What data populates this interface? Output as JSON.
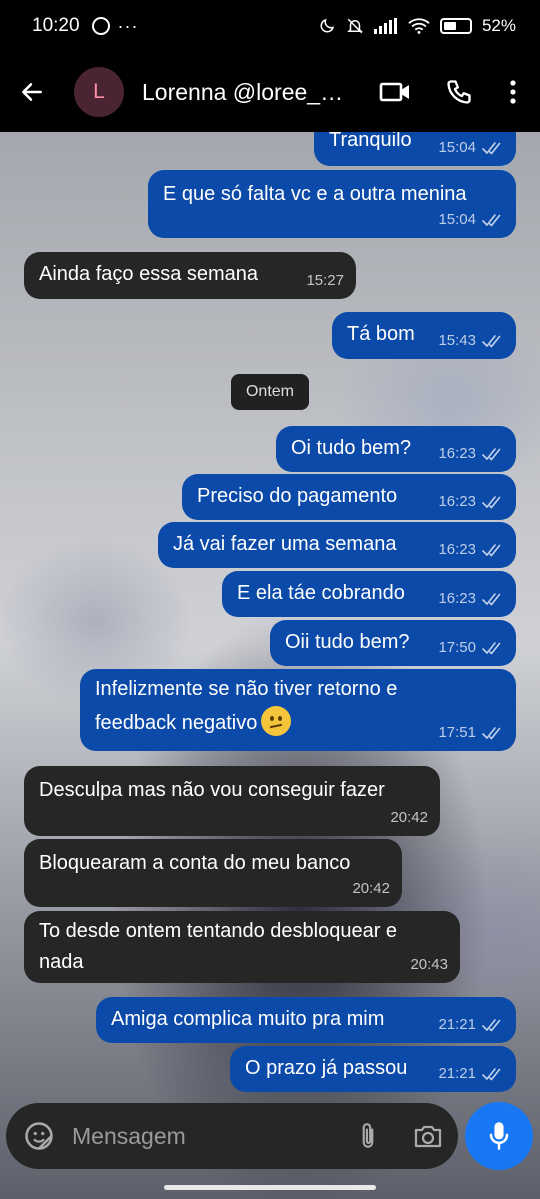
{
  "status_bar": {
    "time": "10:20",
    "extra": "···",
    "battery": "52%",
    "battery_level": 0.52
  },
  "header": {
    "avatar_letter": "L",
    "contact_name": "Lorenna @loree_y..."
  },
  "date_chip": "Ontem",
  "messages": [
    {
      "dir": "out",
      "text": "Tranquilo",
      "time": "15:04"
    },
    {
      "dir": "out",
      "text": "E que só falta vc e a outra menina",
      "time": "15:04"
    },
    {
      "dir": "in",
      "text": "Ainda faço essa semana",
      "time": "15:27"
    },
    {
      "dir": "out",
      "text": "Tá bom",
      "time": "15:43"
    },
    {
      "dir": "out",
      "text": "Oi tudo bem?",
      "time": "16:23"
    },
    {
      "dir": "out",
      "text": "Preciso do pagamento",
      "time": "16:23"
    },
    {
      "dir": "out",
      "text": "Já vai fazer uma semana",
      "time": "16:23"
    },
    {
      "dir": "out",
      "text": "E ela táe cobrando",
      "time": "16:23"
    },
    {
      "dir": "out",
      "text": "Oii tudo bem?",
      "time": "17:50"
    },
    {
      "dir": "out",
      "line1": "Infelizmente se não tiver retorno e",
      "line2": "feedback negativo",
      "emoji": "confused-face",
      "time": "17:51"
    },
    {
      "dir": "in",
      "text": "Desculpa mas não vou conseguir fazer",
      "time": "20:42"
    },
    {
      "dir": "in",
      "text": "Bloquearam a conta do meu banco",
      "time": "20:42"
    },
    {
      "dir": "in",
      "line1": "To desde ontem tentando desbloquear e",
      "line2": "nada",
      "time": "20:43"
    },
    {
      "dir": "out",
      "text": "Amiga complica muito pra mim",
      "time": "21:21"
    },
    {
      "dir": "out",
      "text": "O prazo já passou",
      "time": "21:21"
    }
  ],
  "composer": {
    "placeholder": "Mensagem"
  },
  "colors": {
    "outgoing_bubble": "#0b4aa8",
    "incoming_bubble": "#262626",
    "mic_button": "#1877f2"
  }
}
